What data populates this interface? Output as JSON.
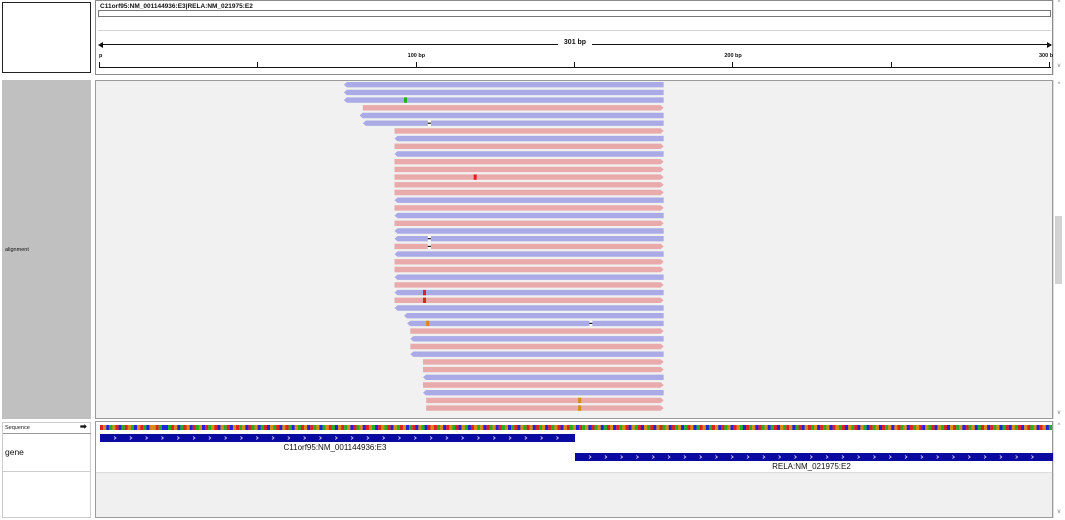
{
  "header": {
    "locus": "C11orf95:NM_001144936:E3|RELA:NM_021975:E2",
    "span_label": "301 bp",
    "ticks": [
      {
        "label": "p",
        "value": 0
      },
      {
        "label": "100 bp",
        "value": 100
      },
      {
        "label": "200 bp",
        "value": 200
      },
      {
        "label": "300 b",
        "value": 300
      }
    ],
    "minor_ticks": [
      50,
      150,
      250
    ]
  },
  "tracks": {
    "alignment_label": "alignment",
    "sequence_label": "Sequence",
    "sequence_arrow": "➡",
    "gene_label": "gene"
  },
  "genes": [
    {
      "name": "C11orf95:NM_001144936:E3",
      "start": 0,
      "end": 150,
      "strand": "+"
    },
    {
      "name": "RELA:NM_021975:E2",
      "start": 150,
      "end": 301,
      "strand": "+"
    }
  ],
  "colors": {
    "forward_read": "#e8aaaa",
    "reverse_read": "#aaaae6",
    "gene": "#0a0aa0",
    "base_A": "#22b022",
    "base_C": "#2222dd",
    "base_G": "#d88a14",
    "base_T": "#dd2222",
    "insertion": "#111111"
  },
  "reads": [
    {
      "s": 77,
      "e": 178,
      "st": "-"
    },
    {
      "s": 77,
      "e": 178,
      "st": "-"
    },
    {
      "s": 77,
      "e": 178,
      "st": "-",
      "m": [
        {
          "p": 96,
          "b": "A"
        }
      ]
    },
    {
      "s": 83,
      "e": 178,
      "st": "+"
    },
    {
      "s": 82,
      "e": 178,
      "st": "-"
    },
    {
      "s": 83,
      "e": 178,
      "st": "-",
      "ins": [
        104
      ]
    },
    {
      "s": 93,
      "e": 178,
      "st": "+"
    },
    {
      "s": 93,
      "e": 178,
      "st": "-"
    },
    {
      "s": 93,
      "e": 178,
      "st": "+"
    },
    {
      "s": 93,
      "e": 178,
      "st": "-"
    },
    {
      "s": 93,
      "e": 178,
      "st": "+"
    },
    {
      "s": 93,
      "e": 178,
      "st": "+"
    },
    {
      "s": 93,
      "e": 178,
      "st": "+",
      "m": [
        {
          "p": 118,
          "b": "T"
        }
      ]
    },
    {
      "s": 93,
      "e": 178,
      "st": "+"
    },
    {
      "s": 93,
      "e": 178,
      "st": "+"
    },
    {
      "s": 93,
      "e": 178,
      "st": "-"
    },
    {
      "s": 93,
      "e": 178,
      "st": "+"
    },
    {
      "s": 93,
      "e": 178,
      "st": "-"
    },
    {
      "s": 93,
      "e": 178,
      "st": "+"
    },
    {
      "s": 93,
      "e": 178,
      "st": "-"
    },
    {
      "s": 93,
      "e": 178,
      "st": "-",
      "ins": [
        104
      ]
    },
    {
      "s": 93,
      "e": 178,
      "st": "+",
      "ins": [
        104
      ]
    },
    {
      "s": 93,
      "e": 178,
      "st": "-"
    },
    {
      "s": 93,
      "e": 178,
      "st": "+"
    },
    {
      "s": 93,
      "e": 178,
      "st": "+"
    },
    {
      "s": 93,
      "e": 178,
      "st": "-"
    },
    {
      "s": 93,
      "e": 178,
      "st": "+"
    },
    {
      "s": 93,
      "e": 178,
      "st": "-",
      "m": [
        {
          "p": 102,
          "b": "T"
        }
      ]
    },
    {
      "s": 93,
      "e": 178,
      "st": "+",
      "m": [
        {
          "p": 102,
          "b": "T"
        }
      ]
    },
    {
      "s": 93,
      "e": 178,
      "st": "-"
    },
    {
      "s": 96,
      "e": 178,
      "st": "-"
    },
    {
      "s": 97,
      "e": 178,
      "st": "-",
      "m": [
        {
          "p": 103,
          "b": "G"
        }
      ],
      "ins": [
        155
      ]
    },
    {
      "s": 98,
      "e": 178,
      "st": "+"
    },
    {
      "s": 98,
      "e": 178,
      "st": "-"
    },
    {
      "s": 98,
      "e": 178,
      "st": "+"
    },
    {
      "s": 98,
      "e": 178,
      "st": "-"
    },
    {
      "s": 102,
      "e": 178,
      "st": "+"
    },
    {
      "s": 102,
      "e": 178,
      "st": "+"
    },
    {
      "s": 102,
      "e": 178,
      "st": "-"
    },
    {
      "s": 102,
      "e": 178,
      "st": "+"
    },
    {
      "s": 102,
      "e": 178,
      "st": "-"
    },
    {
      "s": 103,
      "e": 178,
      "st": "+",
      "m": [
        {
          "p": 151,
          "b": "G"
        }
      ]
    },
    {
      "s": 103,
      "e": 178,
      "st": "+",
      "m": [
        {
          "p": 151,
          "b": "G"
        }
      ]
    }
  ],
  "reference_sequence": "TGCAGTCATGACGTACGGTACCATGCATGCTAGCTAGTCGATCGTAGCTAGCATCGATCGTACGATGCTAGCAGTACGTAGCTAGCTGACTGATCGATGCATCGACTGTAGCTGATCGACTGAGCTAGCTAGCATCGATGCTAGCTAGTCGTAGCTAGCTAGCATGCTAGTCGATCGATCGTAGCTAGCATGCATGCATGCTAGCTGACTAGCTAGCATCGATGCATCGTAGCTAGCTGATCGATCGACTAGCTAGCGTAGCTAGTCGATCGATCGTAGCTAGCATGCTAGCATCGATCGTAGCTGCA"
}
